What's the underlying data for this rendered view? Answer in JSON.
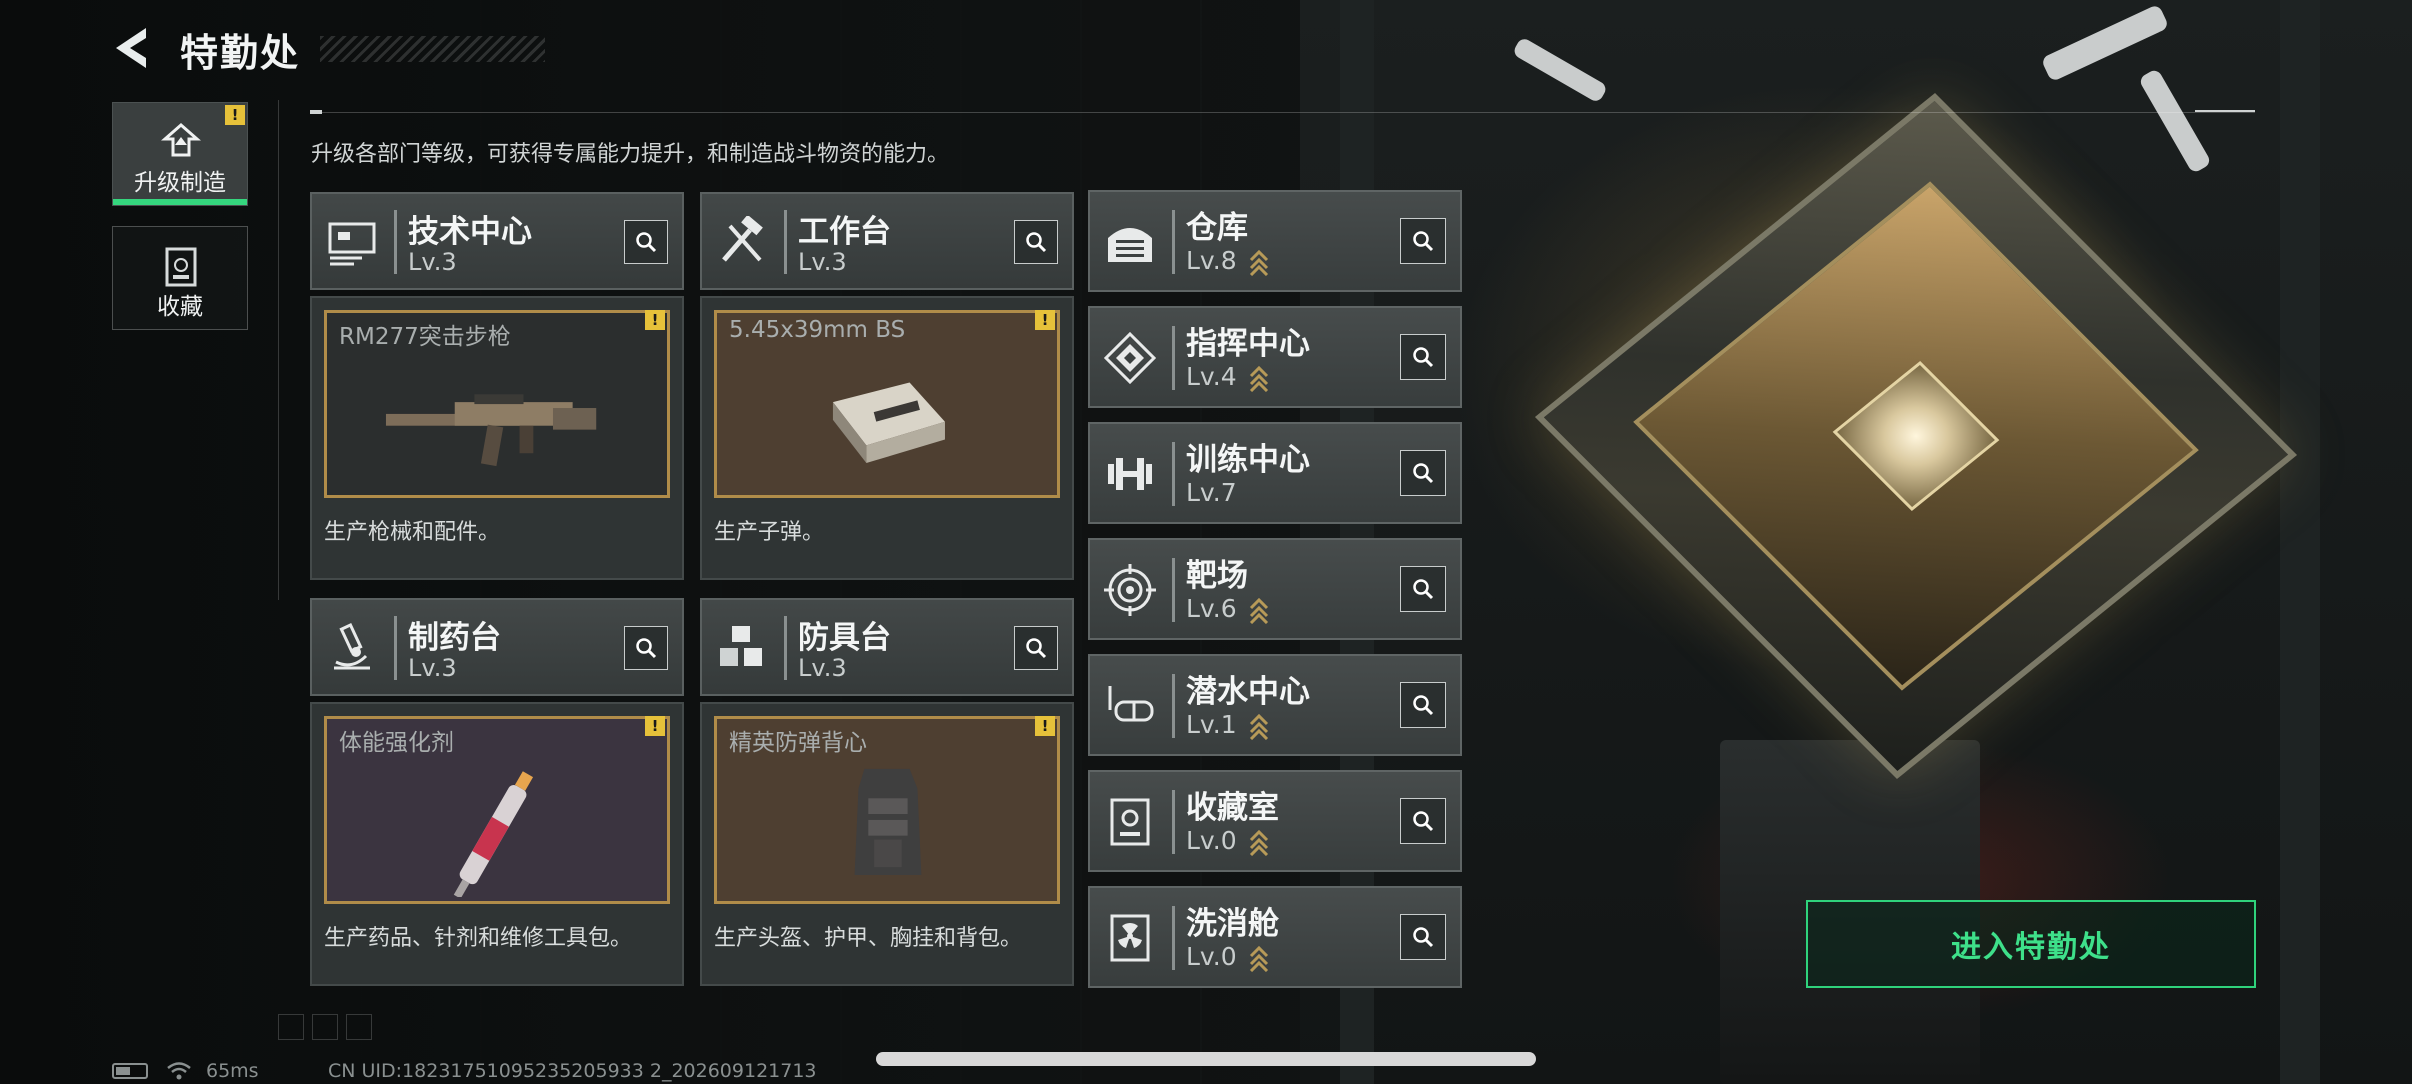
{
  "header": {
    "title": "特勤处",
    "subtitle": "升级各部门等级，可获得专属能力提升，和制造战斗物资的能力。"
  },
  "side_tabs": [
    {
      "label": "升级制造",
      "icon": "upgrade-icon",
      "active": true,
      "alert": "!"
    },
    {
      "label": "收藏",
      "icon": "collection-icon",
      "active": false
    }
  ],
  "production_departments": [
    {
      "name": "技术中心",
      "level": "Lv.3",
      "icon": "computer-icon",
      "item": "RM277突击步枪",
      "desc": "生产枪械和配件。",
      "alert": "!"
    },
    {
      "name": "工作台",
      "level": "Lv.3",
      "icon": "tools-icon",
      "item": "5.45x39mm BS",
      "desc": "生产子弹。",
      "alert": "!"
    },
    {
      "name": "制药台",
      "level": "Lv.3",
      "icon": "microscope-icon",
      "item": "体能强化剂",
      "desc": "生产药品、针剂和维修工具包。",
      "alert": "!"
    },
    {
      "name": "防具台",
      "level": "Lv.3",
      "icon": "cubes-icon",
      "item": "精英防弹背心",
      "desc": "生产头盔、护甲、胸挂和背包。",
      "alert": "!"
    }
  ],
  "departments": [
    {
      "name": "仓库",
      "level": "Lv.8",
      "icon": "warehouse-icon"
    },
    {
      "name": "指挥中心",
      "level": "Lv.4",
      "icon": "command-icon"
    },
    {
      "name": "训练中心",
      "level": "Lv.7",
      "icon": "dumbbell-icon"
    },
    {
      "name": "靶场",
      "level": "Lv.6",
      "icon": "target-icon"
    },
    {
      "name": "潜水中心",
      "level": "Lv.1",
      "icon": "diving-mask-icon"
    },
    {
      "name": "收藏室",
      "level": "Lv.0",
      "icon": "trophy-case-icon"
    },
    {
      "name": "洗消舱",
      "level": "Lv.0",
      "icon": "radiation-icon"
    }
  ],
  "enter_button": "进入特勤处",
  "status": {
    "ping": "65ms",
    "uid": "CN UID:18231751095235205933 2_202609121713"
  },
  "colors": {
    "accent": "#35d67e",
    "alert": "#e6c13a",
    "item_border": "#b08c49"
  }
}
